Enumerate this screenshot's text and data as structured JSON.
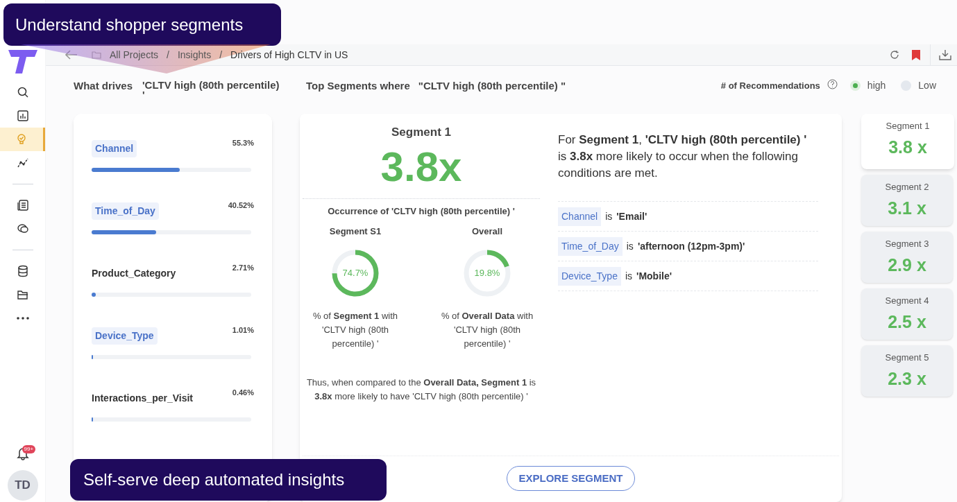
{
  "callouts": [
    {
      "text": "Understand shopper segments"
    },
    {
      "text": "Self-serve deep automated insights"
    }
  ],
  "sidebar": {
    "items": [
      {
        "selected": false
      },
      {
        "selected": false
      },
      {
        "selected": true
      },
      {
        "selected": false
      },
      {
        "selected": false
      },
      {
        "selected": false
      },
      {
        "selected": false
      },
      {
        "selected": false
      },
      {
        "selected": false
      }
    ],
    "notification_badge": "99+",
    "avatar": "TD"
  },
  "breadcrumb": [
    {
      "label": "All Projects",
      "separator": "/"
    },
    {
      "label": "Insights",
      "separator": "/"
    },
    {
      "label": "Drivers of High CLTV in US"
    }
  ],
  "heading": {
    "label": "What drives",
    "target": "'CLTV high (80th percentile) '",
    "segments_label": "Top Segments where",
    "segments_target": "\"CLTV high (80th percentile) \"",
    "recommendations_label": "# of Recommendations",
    "options": [
      {
        "label": "high",
        "selected": true
      },
      {
        "label": "Low",
        "selected": false
      }
    ]
  },
  "drivers": [
    {
      "name": "Channel",
      "value": "55.3%",
      "level": 0.553,
      "highlighted": true
    },
    {
      "name": "Time_of_Day",
      "value": "40.52%",
      "level": 0.4052,
      "highlighted": true
    },
    {
      "name": "Product_Category",
      "value": "2.71%",
      "level": 0.0271,
      "highlighted": false
    },
    {
      "name": "Device_Type",
      "value": "1.01%",
      "level": 0.0101,
      "highlighted": true
    },
    {
      "name": "Interactions_per_Visit",
      "value": "0.46%",
      "level": 0.0046,
      "highlighted": false
    }
  ],
  "segment_detail": {
    "title": "Segment 1",
    "lift": "3.8x",
    "occurrence": "Occurrence of  'CLTV high (80th percentile) '",
    "columns": [
      {
        "title": "Segment S1",
        "reading": "74.7%",
        "level": 0.747,
        "caption": "%  of **Segment 1** with 'CLTV high (80th percentile) '"
      },
      {
        "title": "Overall",
        "reading": "19.8%",
        "level": 0.198,
        "caption": "%  of  **Overall Data** with 'CLTV high (80th percentile) '"
      }
    ],
    "summary": "Thus, when compared to the  **Overall Data, Segment 1** is  **3.8x**  more likely to have  'CLTV high (80th percentile) '",
    "description": "For **Segment 1**, **'CLTV high (80th percentile) '** is **3.8x** more likely to occur when the following conditions are met.",
    "conditions": [
      {
        "feature": "Channel",
        "connector": "is",
        "value": "'Email'"
      },
      {
        "feature": "Time_of_Day",
        "connector": "is",
        "value": "'afternoon (12pm-3pm)'"
      },
      {
        "feature": "Device_Type",
        "connector": "is",
        "value": "'Mobile'"
      }
    ],
    "button": "EXPLORE SEGMENT"
  },
  "segments": [
    {
      "label": "Segment 1",
      "lift": "3.8 x",
      "selected": true
    },
    {
      "label": "Segment 2",
      "lift": "3.1 x",
      "selected": false
    },
    {
      "label": "Segment 3",
      "lift": "2.9 x",
      "selected": false
    },
    {
      "label": "Segment 4",
      "lift": "2.5 x",
      "selected": false
    },
    {
      "label": "Segment 5",
      "lift": "2.3 x",
      "selected": false
    }
  ]
}
